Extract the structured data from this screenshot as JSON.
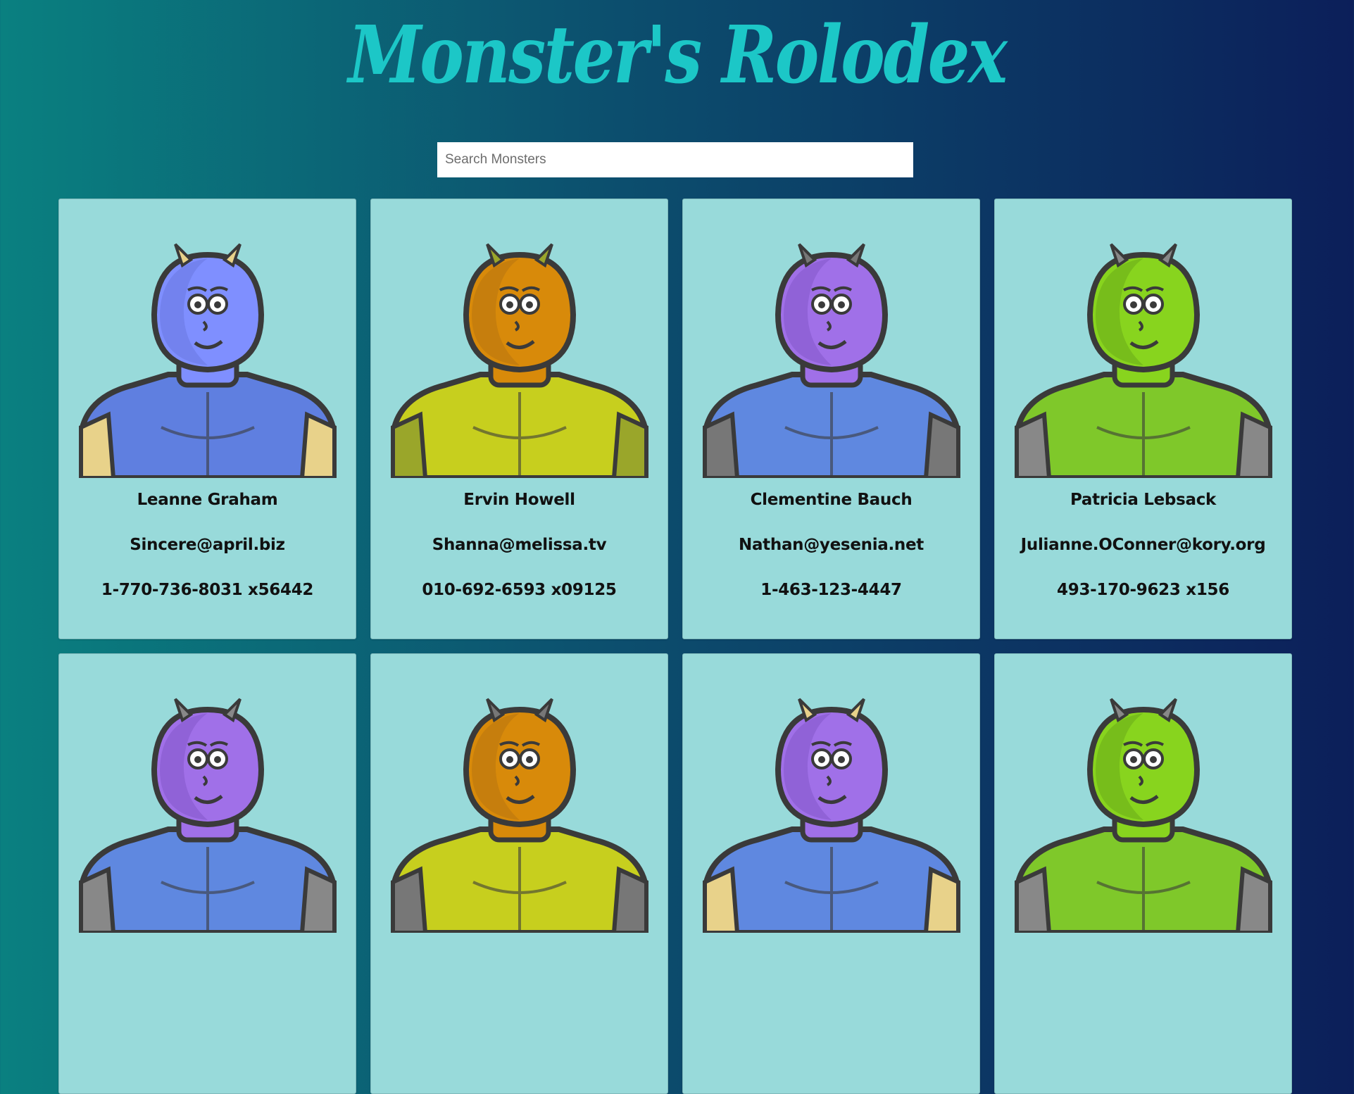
{
  "app": {
    "title": "Monster's Rolodex"
  },
  "search": {
    "placeholder": "Search Monsters",
    "value": ""
  },
  "monsters": [
    {
      "name": "Leanne Graham",
      "email": "Sincere@april.biz",
      "phone": "1-770-736-8031 x56442",
      "skin": "#7f8fff",
      "shade": "#6a78e0",
      "body": "#5f7fe0",
      "accent": "#e8d28a"
    },
    {
      "name": "Ervin Howell",
      "email": "Shanna@melissa.tv",
      "phone": "010-692-6593 x09125",
      "skin": "#d88a0a",
      "shade": "#b87410",
      "body": "#c7cf1e",
      "accent": "#9aa62a"
    },
    {
      "name": "Clementine Bauch",
      "email": "Nathan@yesenia.net",
      "phone": "1-463-123-4447",
      "skin": "#a070e8",
      "shade": "#8458c8",
      "body": "#5f88e0",
      "accent": "#777777"
    },
    {
      "name": "Patricia Lebsack",
      "email": "Julianne.OConner@kory.org",
      "phone": "493-170-9623 x156",
      "skin": "#88d41e",
      "shade": "#6aaa1a",
      "body": "#7fc82a",
      "accent": "#888888"
    },
    {
      "name": "",
      "email": "",
      "phone": "",
      "skin": "#a070e8",
      "shade": "#8458c8",
      "body": "#5f88e0",
      "accent": "#888888"
    },
    {
      "name": "",
      "email": "",
      "phone": "",
      "skin": "#d88a0a",
      "shade": "#b87410",
      "body": "#c7cf1e",
      "accent": "#777777"
    },
    {
      "name": "",
      "email": "",
      "phone": "",
      "skin": "#a070e8",
      "shade": "#8458c8",
      "body": "#5f88e0",
      "accent": "#e8d28a"
    },
    {
      "name": "",
      "email": "",
      "phone": "",
      "skin": "#88d41e",
      "shade": "#6aaa1a",
      "body": "#7fc82a",
      "accent": "#888888"
    }
  ]
}
